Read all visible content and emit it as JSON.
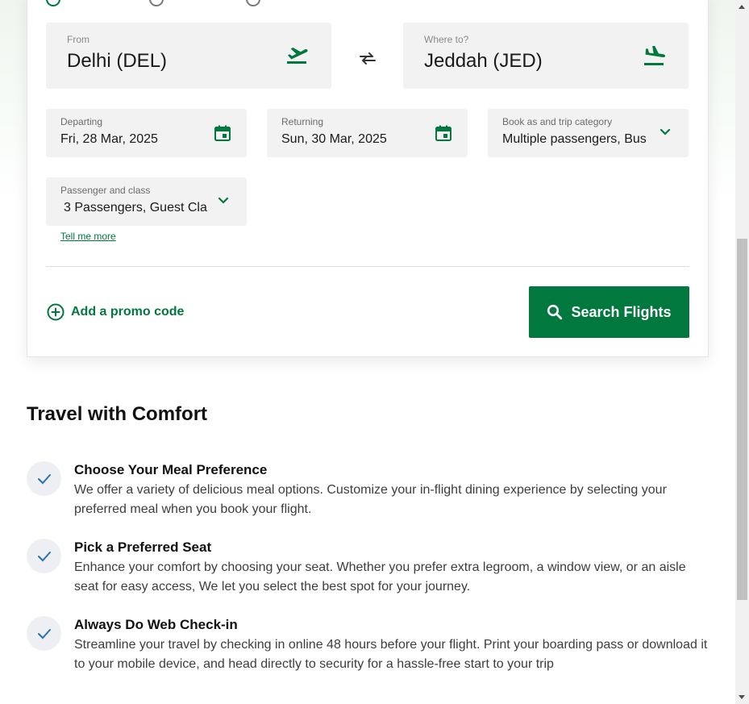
{
  "colors": {
    "brand_green": "#00783e",
    "field_bg": "#f2f2f2"
  },
  "search": {
    "from": {
      "label": "From",
      "value": "Delhi (DEL)",
      "icon": "takeoff-icon"
    },
    "to": {
      "label": "Where to?",
      "value": "Jeddah (JED)",
      "icon": "landing-icon"
    },
    "swap_icon": "swap-icon",
    "departing": {
      "label": "Departing",
      "value": "Fri, 28 Mar, 2025"
    },
    "returning": {
      "label": "Returning",
      "value": "Sun, 30 Mar, 2025"
    },
    "category": {
      "label": "Book as and trip category",
      "value": "Multiple passengers, Bus"
    },
    "passengers": {
      "label": "Passenger and class",
      "value": "3 Passengers, Guest Cla"
    },
    "tell_more": "Tell me more",
    "promo": "Add a promo code",
    "search_button": "Search Flights"
  },
  "comfort": {
    "title": "Travel with Comfort",
    "items": [
      {
        "title": "Choose Your Meal Preference",
        "desc": "We offer a variety of delicious meal options. Customize your in-flight dining experience by selecting your preferred meal when you book your flight."
      },
      {
        "title": "Pick a Preferred Seat",
        "desc": "Enhance your comfort by choosing your seat. Whether you prefer extra legroom, a window view, or an aisle seat for easy access, We let you select the best spot for your journey."
      },
      {
        "title": "Always Do Web Check-in",
        "desc": "Streamline your travel by checking in online 48 hours before your flight. Print your boarding pass or download it to your mobile device, and head directly to security for a hassle-free start to your trip"
      }
    ]
  }
}
